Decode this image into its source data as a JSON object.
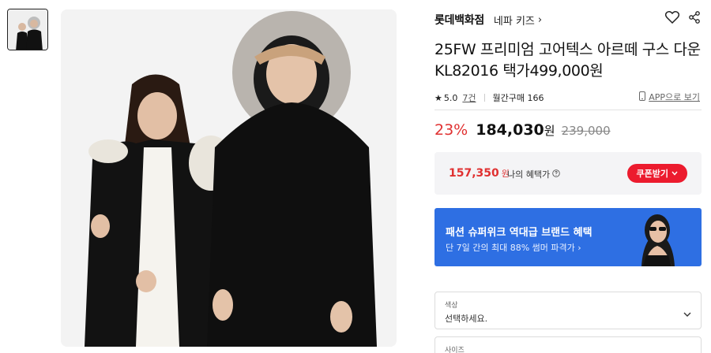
{
  "brand": {
    "name": "롯데백화점",
    "sub": "네파 키즈",
    "sub_chevron": "›"
  },
  "icons": {
    "wishlist": "heart-icon",
    "share": "share-icon"
  },
  "product": {
    "title": "25FW 프리미엄 고어텍스 아르떼 구스 다운 KL82016 택가499,000원",
    "rating": "5.0",
    "reviews": "7건",
    "monthly_purchase": "월간구매 166",
    "app_link": "APP으로 보기"
  },
  "price": {
    "discount": "23%",
    "sale": "184,030",
    "won": "원",
    "original": "239,000"
  },
  "benefit": {
    "price": "157,350",
    "won": "원",
    "label": "나의 혜택가",
    "coupon_button": "쿠폰받기"
  },
  "banner": {
    "title": "패션 슈퍼위크 역대급 브랜드 혜택",
    "subtitle": "단 7일 간의 최대 88% 썸머 파격가 ›"
  },
  "options": [
    {
      "label": "색상",
      "value": "선택하세요."
    },
    {
      "label": "사이즈",
      "value": ""
    }
  ],
  "colors": {
    "accent_red": "#e03131",
    "coupon_red": "#ec1b2e",
    "banner_blue": "#2e6fe3"
  }
}
